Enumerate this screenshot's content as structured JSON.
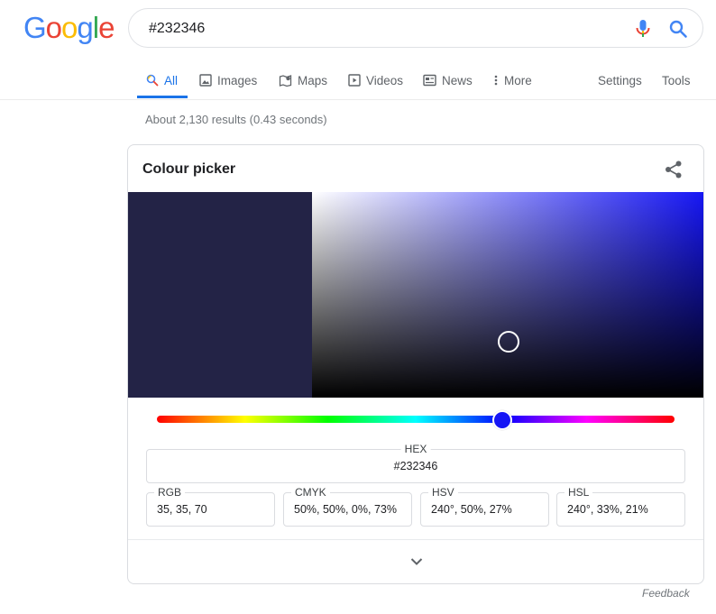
{
  "logo": {
    "letters": [
      "G",
      "o",
      "o",
      "g",
      "l",
      "e"
    ],
    "colors": [
      "#4285f4",
      "#ea4335",
      "#fbbc05",
      "#4285f4",
      "#34a853",
      "#ea4335"
    ]
  },
  "search": {
    "query": "#232346",
    "mic_icon": "mic-icon",
    "search_icon": "search-icon"
  },
  "tabs": {
    "items": [
      {
        "label": "All",
        "icon": "search-icon",
        "active": true
      },
      {
        "label": "Images",
        "icon": "image-icon"
      },
      {
        "label": "Maps",
        "icon": "map-icon"
      },
      {
        "label": "Videos",
        "icon": "video-icon"
      },
      {
        "label": "News",
        "icon": "news-icon"
      },
      {
        "label": "More",
        "icon": "more-vert-icon"
      }
    ],
    "settings": "Settings",
    "tools": "Tools",
    "accent": "#1a73e8"
  },
  "result_stats": "About 2,130 results (0.43 seconds)",
  "color_picker": {
    "title": "Colour picker",
    "share_icon": "share-icon",
    "selected_color": "#232346",
    "hue_color": "#1616f5",
    "hue_degrees": 240,
    "saturation": 0.5,
    "value": 0.27,
    "hex": {
      "label": "HEX",
      "value": "#232346"
    },
    "rgb": {
      "label": "RGB",
      "value": "35, 35, 70"
    },
    "cmyk": {
      "label": "CMYK",
      "value": "50%, 50%, 0%, 73%"
    },
    "hsv": {
      "label": "HSV",
      "value": "240°, 50%, 27%"
    },
    "hsl": {
      "label": "HSL",
      "value": "240°, 33%, 21%"
    },
    "expand_icon": "chevron-down-icon"
  },
  "feedback": "Feedback"
}
